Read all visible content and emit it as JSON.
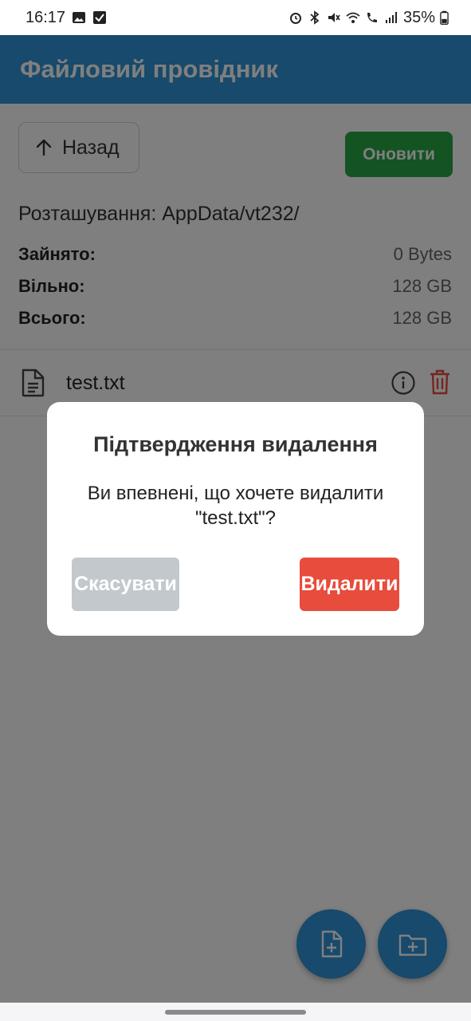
{
  "status_bar": {
    "time": "16:17",
    "battery": "35%"
  },
  "app_bar": {
    "title": "Файловий провідник"
  },
  "toolbar": {
    "back_label": "Назад",
    "refresh_label": "Оновити"
  },
  "location": "Розташування: AppData/vt232/",
  "storage": {
    "used_label": "Зайнято:",
    "used_value": "0 Bytes",
    "free_label": "Вільно:",
    "free_value": "128 GB",
    "total_label": "Всього:",
    "total_value": "128 GB"
  },
  "files": [
    {
      "name": "test.txt"
    }
  ],
  "dialog": {
    "title": "Підтвердження видалення",
    "message": "Ви впевнені, що хочете видалити \"test.txt\"?",
    "cancel_label": "Скасувати",
    "delete_label": "Видалити"
  },
  "colors": {
    "primary": "#2f95d8",
    "refresh": "#28a745",
    "danger": "#e74c3c",
    "cancel": "#c3c8cd"
  },
  "icons": {
    "back": "arrow-up-icon",
    "file": "document-icon",
    "info": "info-icon",
    "delete": "trash-icon",
    "new_file": "file-plus-icon",
    "new_folder": "folder-plus-icon"
  }
}
